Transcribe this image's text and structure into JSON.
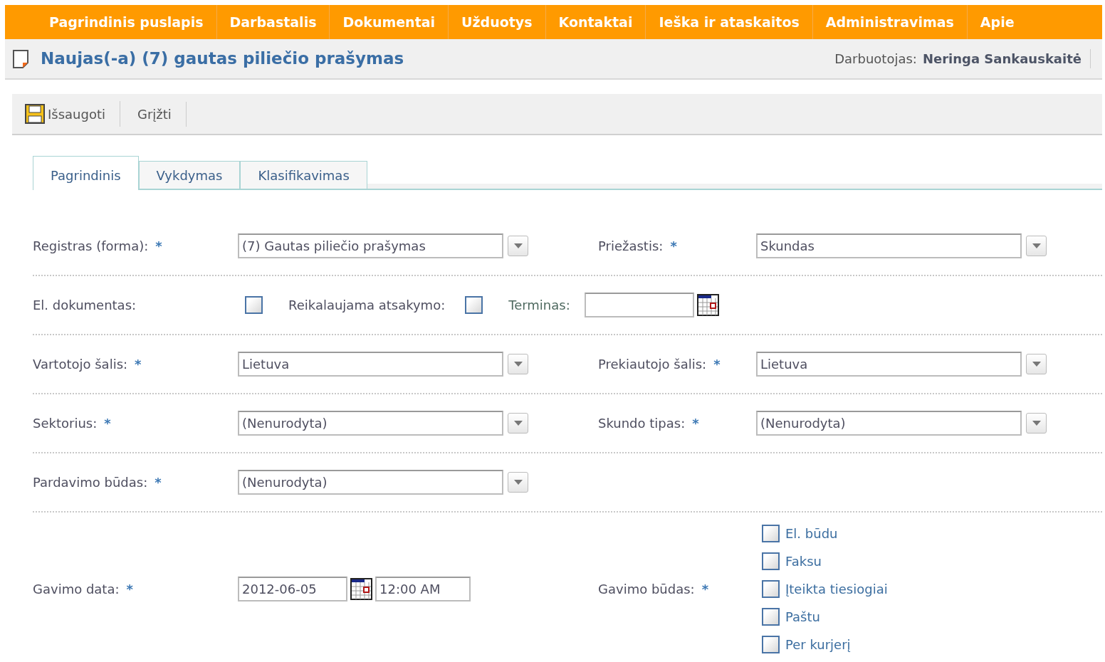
{
  "menu": [
    {
      "label": "Pagrindinis puslapis"
    },
    {
      "label": "Darbastalis"
    },
    {
      "label": "Dokumentai"
    },
    {
      "label": "Užduotys"
    },
    {
      "label": "Kontaktai"
    },
    {
      "label": "Ieška ir ataskaitos"
    },
    {
      "label": "Administravimas"
    },
    {
      "label": "Apie"
    }
  ],
  "header": {
    "title": "Naujas(-a) (7) gautas piliečio prašymas",
    "user_label": "Darbuotojas:",
    "user_name": "Neringa Sankauskaitė"
  },
  "toolbar": [
    {
      "label": "Išsaugoti",
      "kind": "save"
    },
    {
      "label": "Grįžti",
      "kind": "plain"
    }
  ],
  "tabs": [
    {
      "label": "Pagrindinis",
      "selected": true
    },
    {
      "label": "Vykdymas",
      "selected": false
    },
    {
      "label": "Klasifikavimas",
      "selected": false
    }
  ],
  "form": {
    "rows": [
      {
        "kind": "pair",
        "left": {
          "label": "Registras (forma):",
          "mark": "*",
          "value": "(7) Gautas piliečio prašymas"
        },
        "right": {
          "label": "Priežastis:",
          "mark": "*",
          "value": "Skundas"
        }
      },
      {
        "kind": "flags",
        "label": "El. dokumentas:",
        "checked": false,
        "answer": {
          "label": "Reikalaujama atsakymo:",
          "checked": false
        },
        "term": {
          "label": "Terminas:"
        }
      },
      {
        "kind": "pair",
        "left": {
          "label": "Vartotojo šalis:",
          "mark": "*",
          "value": "Lietuva"
        },
        "right": {
          "label": "Prekiautojo šalis:",
          "mark": "*",
          "value": "Lietuva"
        }
      },
      {
        "kind": "pair",
        "left": {
          "label": "Sektorius:",
          "mark": "*",
          "value": "(Nenurodyta)"
        },
        "right": {
          "label": "Skundo tipas:",
          "mark": "*",
          "value": "(Nenurodyta)"
        }
      },
      {
        "kind": "single",
        "left": {
          "label": "Pardavimo būdas:",
          "mark": "*",
          "value": "(Nenurodyta)"
        }
      },
      {
        "kind": "receipt",
        "left": {
          "label": "Gavimo data:",
          "mark": "*",
          "date": "2012-06-05",
          "time": "12:00 AM"
        },
        "right": {
          "label": "Gavimo būdas:",
          "mark": "*",
          "options": [
            {
              "label": "El. būdu",
              "checked": false
            },
            {
              "label": "Faksu",
              "checked": false
            },
            {
              "label": "Įteikta tiesiogiai",
              "checked": false
            },
            {
              "label": "Paštu",
              "checked": false
            },
            {
              "label": "Per kurjerį",
              "checked": false
            }
          ]
        }
      }
    ]
  }
}
